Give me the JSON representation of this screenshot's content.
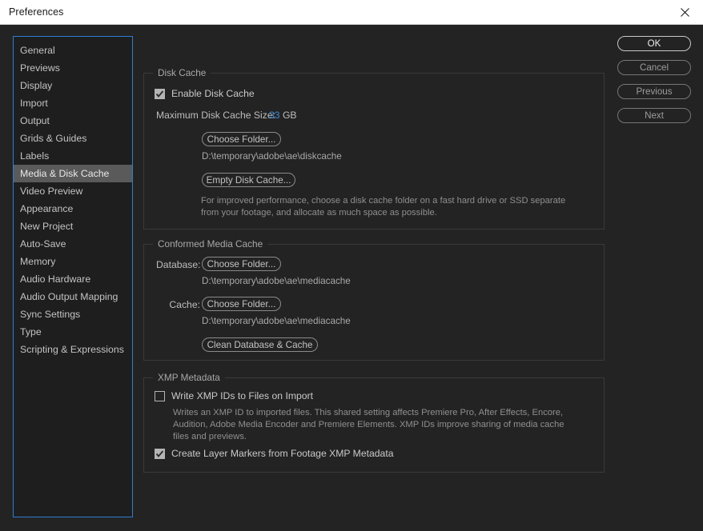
{
  "window": {
    "title": "Preferences",
    "close_icon": "close-icon"
  },
  "sidebar": {
    "items": [
      {
        "label": "General",
        "selected": false
      },
      {
        "label": "Previews",
        "selected": false
      },
      {
        "label": "Display",
        "selected": false
      },
      {
        "label": "Import",
        "selected": false
      },
      {
        "label": "Output",
        "selected": false
      },
      {
        "label": "Grids & Guides",
        "selected": false
      },
      {
        "label": "Labels",
        "selected": false
      },
      {
        "label": "Media & Disk Cache",
        "selected": true
      },
      {
        "label": "Video Preview",
        "selected": false
      },
      {
        "label": "Appearance",
        "selected": false
      },
      {
        "label": "New Project",
        "selected": false
      },
      {
        "label": "Auto-Save",
        "selected": false
      },
      {
        "label": "Memory",
        "selected": false
      },
      {
        "label": "Audio Hardware",
        "selected": false
      },
      {
        "label": "Audio Output Mapping",
        "selected": false
      },
      {
        "label": "Sync Settings",
        "selected": false
      },
      {
        "label": "Type",
        "selected": false
      },
      {
        "label": "Scripting & Expressions",
        "selected": false
      }
    ]
  },
  "actions": {
    "ok": "OK",
    "cancel": "Cancel",
    "previous": "Previous",
    "next": "Next"
  },
  "disk_cache": {
    "legend": "Disk Cache",
    "enable_label": "Enable Disk Cache",
    "enable_checked": true,
    "max_size_label": "Maximum Disk Cache Size:",
    "max_size_value": "33",
    "max_size_unit": "GB",
    "choose_folder_label": "Choose Folder...",
    "folder_path": "D:\\temporary\\adobe\\ae\\diskcache",
    "empty_cache_label": "Empty Disk Cache...",
    "hint": "For improved performance, choose a disk cache folder on a fast hard drive or SSD separate from your footage, and allocate as much space as possible."
  },
  "media_cache": {
    "legend": "Conformed Media Cache",
    "database_label": "Database:",
    "database_button": "Choose Folder...",
    "database_path": "D:\\temporary\\adobe\\ae\\mediacache",
    "cache_label": "Cache:",
    "cache_button": "Choose Folder...",
    "cache_path": "D:\\temporary\\adobe\\ae\\mediacache",
    "clean_button": "Clean Database & Cache"
  },
  "xmp": {
    "legend": "XMP Metadata",
    "write_label": "Write XMP IDs to Files on Import",
    "write_checked": false,
    "hint": "Writes an XMP ID to imported files. This shared setting affects Premiere Pro, After Effects, Encore, Audition, Adobe Media Encoder and Premiere Elements. XMP IDs improve sharing of media cache files and previews.",
    "markers_label": "Create Layer Markers from Footage XMP Metadata",
    "markers_checked": true
  },
  "colors": {
    "dialog_background": "#232323",
    "titlebar_background": "#ffffff",
    "focus_border": "#2d7dd2",
    "selection_background": "#5a5a5a",
    "hot_text": "#3d86d4"
  }
}
